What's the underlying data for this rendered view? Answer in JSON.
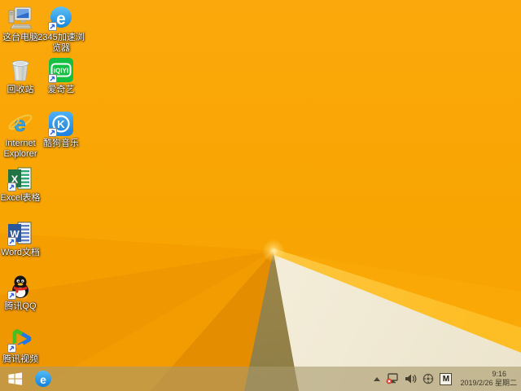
{
  "desktop": {
    "icons": [
      {
        "name": "this-pc",
        "label": "这台电脑"
      },
      {
        "name": "recycle-bin",
        "label": "回收站"
      },
      {
        "name": "internet-explorer",
        "label": "Internet Explorer"
      },
      {
        "name": "excel",
        "label": "Excel表格"
      },
      {
        "name": "word",
        "label": "Word文档"
      },
      {
        "name": "qq",
        "label": "腾讯QQ"
      },
      {
        "name": "tencent-video",
        "label": "腾讯视频"
      },
      {
        "name": "browser-2345",
        "label": "2345加速浏览器"
      },
      {
        "name": "iqiyi",
        "label": "爱奇艺"
      },
      {
        "name": "kugou-music",
        "label": "酷狗音乐"
      }
    ]
  },
  "taskbar": {
    "tray": {
      "time": "9:16",
      "date": "2019/2/26 星期二",
      "input_indicator": "M"
    }
  },
  "glyphs": {
    "browser_e": "e",
    "ie_e": "e",
    "iqiyi_wordmark": "iQIYI",
    "kugou_k": "K",
    "excel_x": "X",
    "word_w": "W"
  },
  "colors": {
    "wallpaper_orange": "#f8a400",
    "wallpaper_cream": "#f4eedd",
    "wallpaper_olive": "#a0894b",
    "wallpaper_edge_gold": "#fdbd24",
    "taskbar_tint": "#c7a463",
    "ie_blue": "#3ba0e8",
    "iqiyi_green": "#13bf3f",
    "kugou_blue": "#2a97f0",
    "qq_scarf_red": "#e02a1e",
    "excel_green": "#217346",
    "word_blue": "#2b579a"
  }
}
